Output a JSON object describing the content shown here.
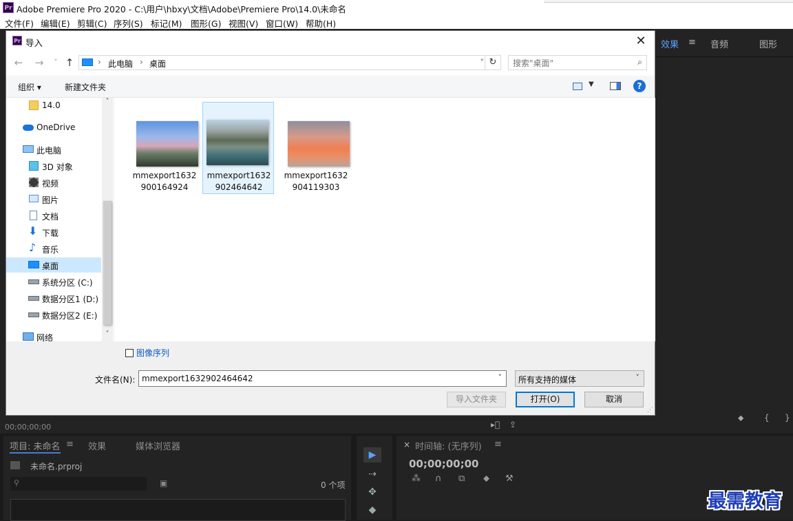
{
  "app": {
    "logo": "Pr",
    "title": "Adobe Premiere Pro 2020 - C:\\用户\\hbxy\\文档\\Adobe\\Premiere Pro\\14.0\\未命名"
  },
  "menus": [
    "文件(F)",
    "编辑(E)",
    "剪辑(C)",
    "序列(S)",
    "标记(M)",
    "图形(G)",
    "视图(V)",
    "窗口(W)",
    "帮助(H)"
  ],
  "premiere": {
    "right_tabs": [
      "效果",
      "≡",
      "音频",
      "图形"
    ],
    "source_timecode": "00;00;00;00",
    "project_tabs": [
      "项目: 未命名",
      "≡",
      "效果",
      "媒体浏览器"
    ],
    "project_file": "未命名.prproj",
    "item_count": "0 个项",
    "timeline_tab": "时间轴: (无序列)",
    "timeline_menu": "≡",
    "timeline_close": "×",
    "timeline_timecode": "00;00;00;00"
  },
  "dialog": {
    "title": "导入",
    "close_glyph": "✕",
    "nav": {
      "back": "←",
      "forward": "→",
      "recent": "˅",
      "up": "↑"
    },
    "breadcrumb": [
      "此电脑",
      "桌面"
    ],
    "breadcrumb_sep": "›",
    "search_placeholder": "搜索\"桌面\"",
    "toolbar": {
      "organize": "组织 ▾",
      "new_folder": "新建文件夹",
      "help": "?"
    },
    "nav_items": [
      {
        "label": "14.0",
        "icon": "folder-icon"
      },
      {
        "label": "OneDrive",
        "icon": "cloud-icon"
      },
      {
        "label": "此电脑",
        "icon": "computer-icon"
      },
      {
        "label": "3D 对象",
        "icon": "cube-icon"
      },
      {
        "label": "视频",
        "icon": "video-icon"
      },
      {
        "label": "图片",
        "icon": "picture-icon"
      },
      {
        "label": "文档",
        "icon": "document-icon"
      },
      {
        "label": "下载",
        "icon": "download-icon"
      },
      {
        "label": "音乐",
        "icon": "music-icon"
      },
      {
        "label": "桌面",
        "icon": "desktop-icon",
        "selected": true
      },
      {
        "label": "系统分区 (C:)",
        "icon": "drive-icon"
      },
      {
        "label": "数据分区1 (D:)",
        "icon": "drive-icon"
      },
      {
        "label": "数据分区2 (E:)",
        "icon": "drive-icon"
      },
      {
        "label": "网络",
        "icon": "network-icon"
      }
    ],
    "files": [
      {
        "name_line1": "mmexport1632",
        "name_line2": "900164924",
        "selected": false
      },
      {
        "name_line1": "mmexport1632",
        "name_line2": "902464642",
        "selected": true
      },
      {
        "name_line1": "mmexport1632",
        "name_line2": "904119303",
        "selected": false
      }
    ],
    "image_sequence_label": "图像序列",
    "filename_label": "文件名(N):",
    "filename_value": "mmexport1632902464642",
    "filetype_value": "所有支持的媒体",
    "buttons": {
      "import_folder": "导入文件夹",
      "open": "打开(O)",
      "cancel": "取消"
    }
  },
  "watermark": "最需教育",
  "colors": {
    "accent": "#0078d7",
    "selection": "#cce8ff",
    "premiere_bg": "#232323",
    "tab_active": "#5aa0ff"
  }
}
